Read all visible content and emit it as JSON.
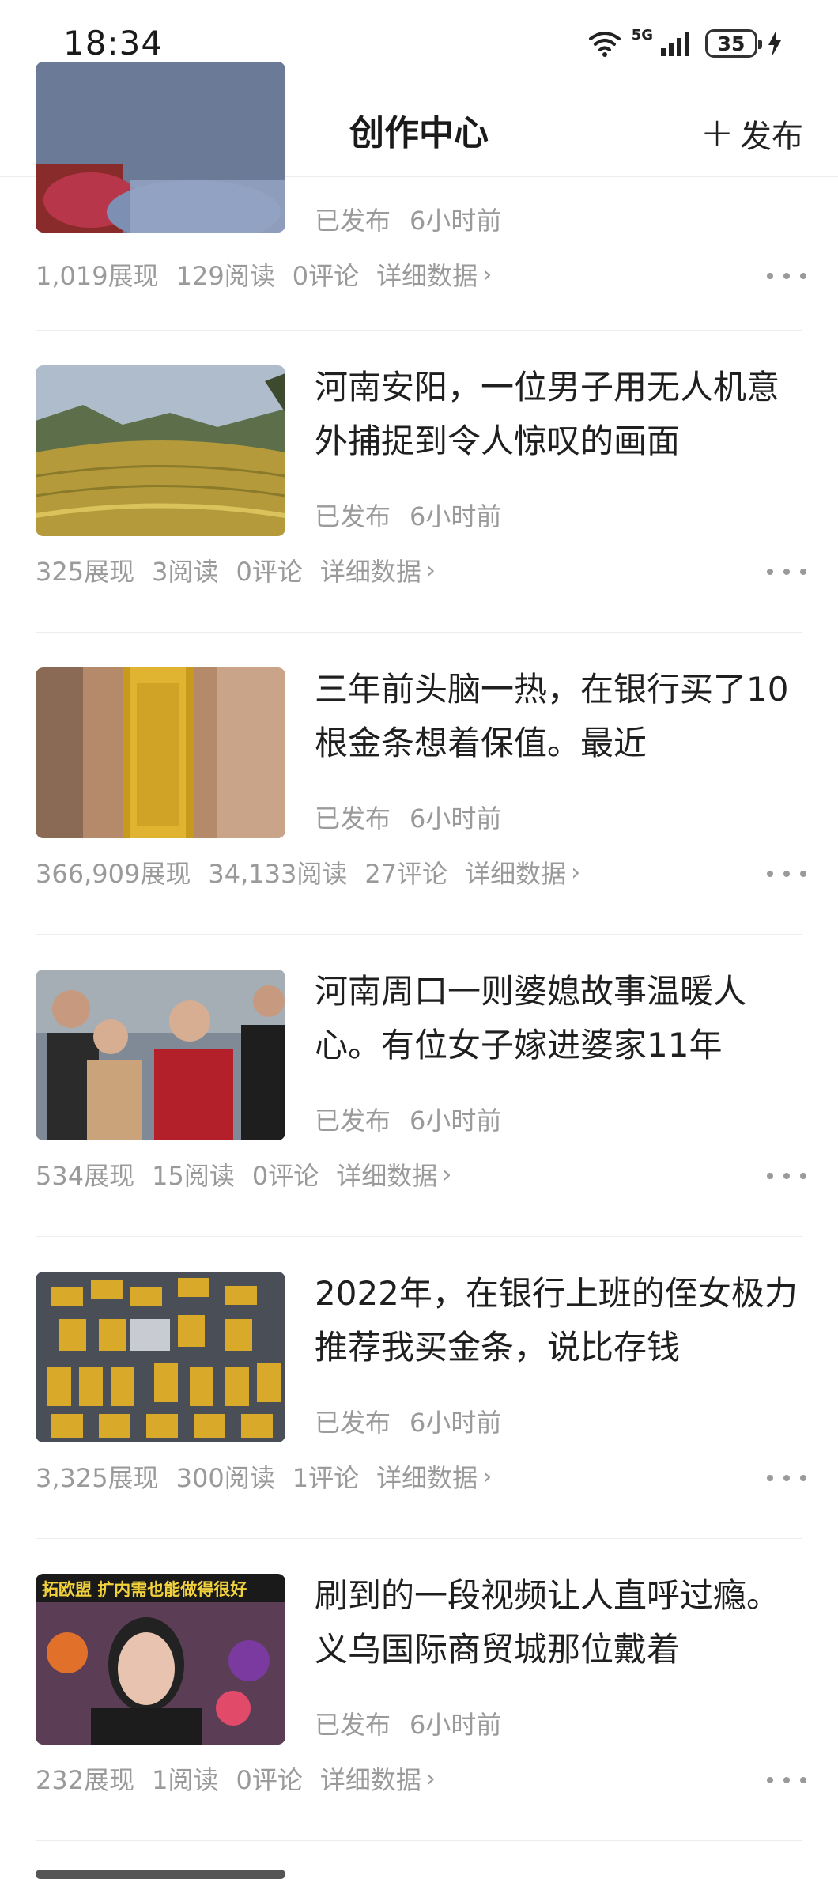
{
  "status": {
    "time": "18:34",
    "network": "5G",
    "battery": "35"
  },
  "nav": {
    "title": "创作中心",
    "publish": "发布"
  },
  "labels": {
    "published": "已发布",
    "detail": "详细数据"
  },
  "articles": [
    {
      "title": "",
      "time": "6小时前",
      "views": "1,019展现",
      "reads": "129阅读",
      "comments": "0评论"
    },
    {
      "title": "河南安阳，一位男子用无人机意外捕捉到令人惊叹的画面",
      "time": "6小时前",
      "views": "325展现",
      "reads": "3阅读",
      "comments": "0评论"
    },
    {
      "title": "三年前头脑一热，在银行买了10根金条想着保值。最近",
      "time": "6小时前",
      "views": "366,909展现",
      "reads": "34,133阅读",
      "comments": "27评论"
    },
    {
      "title": "河南周口一则婆媳故事温暖人心。有位女子嫁进婆家11年",
      "time": "6小时前",
      "views": "534展现",
      "reads": "15阅读",
      "comments": "0评论"
    },
    {
      "title": "2022年，在银行上班的侄女极力推荐我买金条，说比存钱",
      "time": "6小时前",
      "views": "3,325展现",
      "reads": "300阅读",
      "comments": "1评论"
    },
    {
      "title": "刷到的一段视频让人直呼过瘾。义乌国际商贸城那位戴着",
      "time": "6小时前",
      "views": "232展现",
      "reads": "1阅读",
      "comments": "0评论"
    }
  ],
  "thumb_caption": "拓欧盟 扩内需也能做得很好",
  "colors": {
    "meta": "#9a9a9a",
    "title": "#1f1f1f",
    "gold": "#d4a520"
  }
}
